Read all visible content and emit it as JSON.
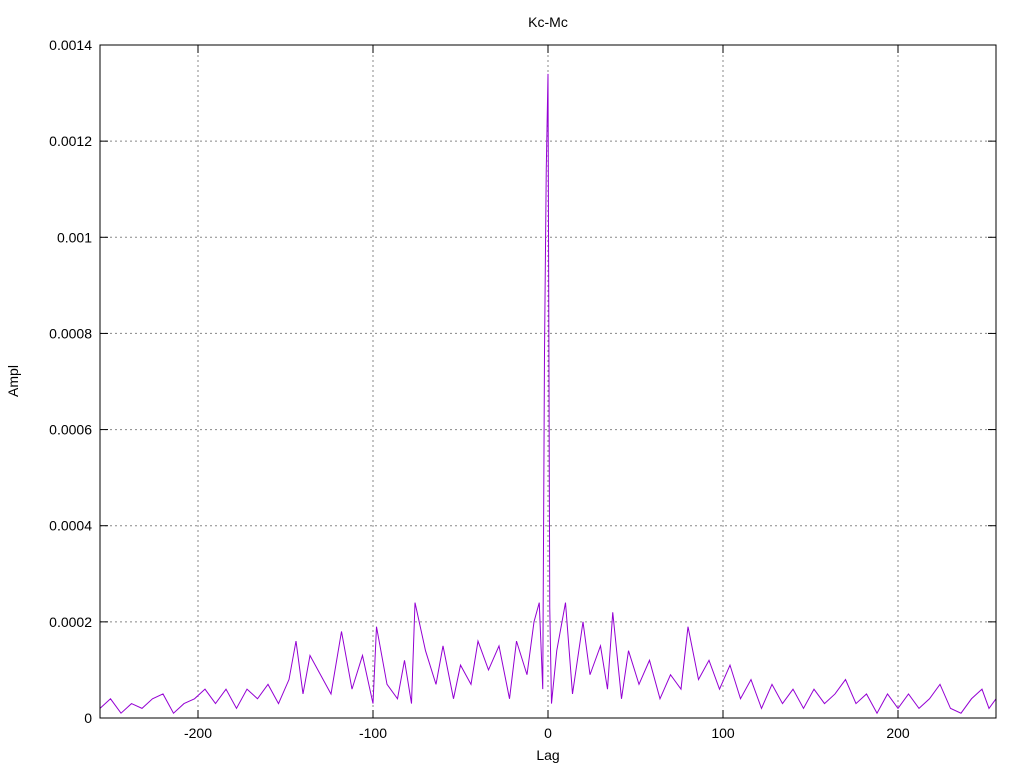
{
  "chart_data": {
    "type": "line",
    "title": "Kc-Mc",
    "xlabel": "Lag",
    "ylabel": "Ampl",
    "xlim": [
      -256,
      256
    ],
    "ylim": [
      0,
      0.0014
    ],
    "xticks": [
      -200,
      -100,
      0,
      100,
      200
    ],
    "xtick_labels": [
      "-200",
      "-100",
      "0",
      "100",
      "200"
    ],
    "yticks": [
      0,
      0.0002,
      0.0004,
      0.0006,
      0.0008,
      0.001,
      0.0012,
      0.0014
    ],
    "ytick_labels": [
      "0",
      "0.0002",
      "0.0004",
      "0.0006",
      "0.0008",
      "0.001",
      "0.0012",
      "0.0014"
    ],
    "grid": true,
    "legend": "none",
    "series_color": "#9400d3",
    "series": [
      {
        "points": [
          [
            -256,
            2e-05
          ],
          [
            -250,
            4e-05
          ],
          [
            -244,
            1e-05
          ],
          [
            -238,
            3e-05
          ],
          [
            -232,
            2e-05
          ],
          [
            -226,
            4e-05
          ],
          [
            -220,
            5e-05
          ],
          [
            -214,
            1e-05
          ],
          [
            -208,
            3e-05
          ],
          [
            -202,
            4e-05
          ],
          [
            -196,
            6e-05
          ],
          [
            -190,
            3e-05
          ],
          [
            -184,
            6e-05
          ],
          [
            -178,
            2e-05
          ],
          [
            -172,
            6e-05
          ],
          [
            -166,
            4e-05
          ],
          [
            -160,
            7e-05
          ],
          [
            -154,
            3e-05
          ],
          [
            -148,
            8e-05
          ],
          [
            -144,
            0.00016
          ],
          [
            -140,
            5e-05
          ],
          [
            -136,
            0.00013
          ],
          [
            -130,
            9e-05
          ],
          [
            -124,
            5e-05
          ],
          [
            -118,
            0.00018
          ],
          [
            -112,
            6e-05
          ],
          [
            -106,
            0.00013
          ],
          [
            -100,
            3e-05
          ],
          [
            -98,
            0.00019
          ],
          [
            -92,
            7e-05
          ],
          [
            -86,
            4e-05
          ],
          [
            -82,
            0.00012
          ],
          [
            -78,
            3e-05
          ],
          [
            -76,
            0.00024
          ],
          [
            -70,
            0.00014
          ],
          [
            -64,
            7e-05
          ],
          [
            -60,
            0.00015
          ],
          [
            -54,
            4e-05
          ],
          [
            -50,
            0.00011
          ],
          [
            -44,
            7e-05
          ],
          [
            -40,
            0.00016
          ],
          [
            -34,
            0.0001
          ],
          [
            -28,
            0.00015
          ],
          [
            -22,
            4e-05
          ],
          [
            -18,
            0.00016
          ],
          [
            -12,
            9e-05
          ],
          [
            -8,
            0.0002
          ],
          [
            -5,
            0.00024
          ],
          [
            -3,
            6e-05
          ],
          [
            -2,
            0.00076
          ],
          [
            -1,
            0.00114
          ],
          [
            0,
            0.00134
          ],
          [
            1,
            0.00023
          ],
          [
            2,
            3e-05
          ],
          [
            5,
            0.00014
          ],
          [
            10,
            0.00024
          ],
          [
            14,
            5e-05
          ],
          [
            20,
            0.0002
          ],
          [
            24,
            9e-05
          ],
          [
            30,
            0.00015
          ],
          [
            34,
            6e-05
          ],
          [
            37,
            0.00022
          ],
          [
            42,
            4e-05
          ],
          [
            46,
            0.00014
          ],
          [
            52,
            7e-05
          ],
          [
            58,
            0.00012
          ],
          [
            64,
            4e-05
          ],
          [
            70,
            9e-05
          ],
          [
            76,
            6e-05
          ],
          [
            80,
            0.00019
          ],
          [
            86,
            8e-05
          ],
          [
            92,
            0.00012
          ],
          [
            98,
            6e-05
          ],
          [
            104,
            0.00011
          ],
          [
            110,
            4e-05
          ],
          [
            116,
            8e-05
          ],
          [
            122,
            2e-05
          ],
          [
            128,
            7e-05
          ],
          [
            134,
            3e-05
          ],
          [
            140,
            6e-05
          ],
          [
            146,
            2e-05
          ],
          [
            152,
            6e-05
          ],
          [
            158,
            3e-05
          ],
          [
            164,
            5e-05
          ],
          [
            170,
            8e-05
          ],
          [
            176,
            3e-05
          ],
          [
            182,
            5e-05
          ],
          [
            188,
            1e-05
          ],
          [
            194,
            5e-05
          ],
          [
            200,
            2e-05
          ],
          [
            206,
            5e-05
          ],
          [
            212,
            2e-05
          ],
          [
            218,
            4e-05
          ],
          [
            224,
            7e-05
          ],
          [
            230,
            2e-05
          ],
          [
            236,
            1e-05
          ],
          [
            242,
            4e-05
          ],
          [
            248,
            6e-05
          ],
          [
            252,
            2e-05
          ],
          [
            256,
            4e-05
          ]
        ]
      }
    ]
  }
}
